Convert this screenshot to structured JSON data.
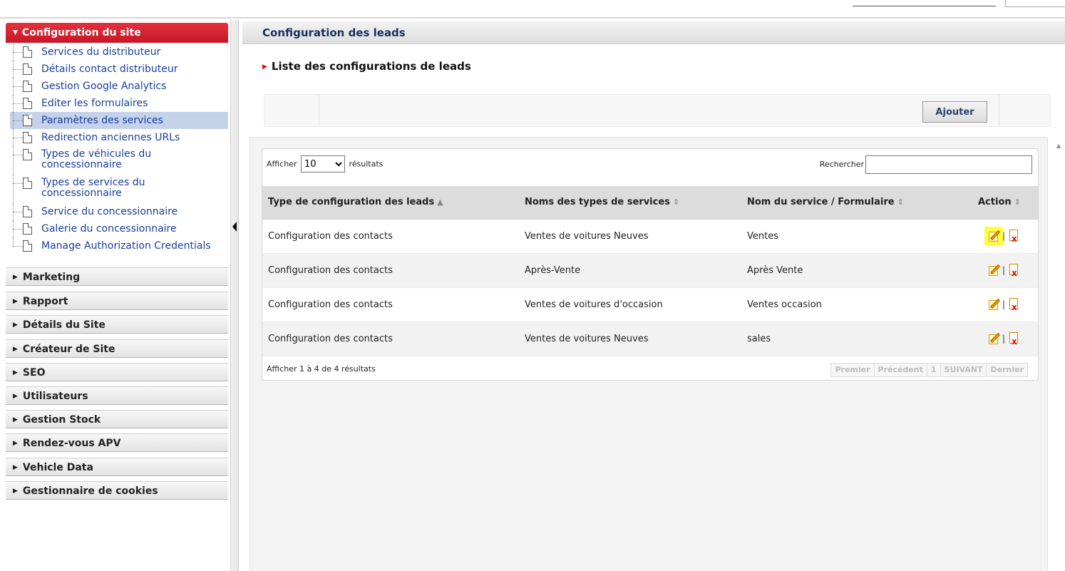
{
  "sidebar": {
    "active_section": "Configuration du site",
    "items": [
      {
        "label": "Services du distributeur"
      },
      {
        "label": "Détails contact distributeur"
      },
      {
        "label": "Gestion Google Analytics"
      },
      {
        "label": "Editer les formulaires"
      },
      {
        "label": "Paramètres des services"
      },
      {
        "label": "Redirection anciennes URLs"
      },
      {
        "label": "Types de véhicules du concessionnaire"
      },
      {
        "label": "Types de services du concessionnaire"
      },
      {
        "label": "Service du concessionnaire"
      },
      {
        "label": "Galerie du concessionnaire"
      },
      {
        "label": "Manage Authorization Credentials"
      }
    ],
    "sections": [
      {
        "label": "Marketing"
      },
      {
        "label": "Rapport"
      },
      {
        "label": "Détails du Site"
      },
      {
        "label": "Créateur de Site"
      },
      {
        "label": "SEO"
      },
      {
        "label": "Utilisateurs"
      },
      {
        "label": "Gestion Stock"
      },
      {
        "label": "Rendez-vous APV"
      },
      {
        "label": "Vehicle Data"
      },
      {
        "label": "Gestionnaire de cookies"
      }
    ]
  },
  "main": {
    "page_title": "Configuration des leads",
    "subtitle": "Liste des configurations de leads",
    "add_button": "Ajouter",
    "length_prefix": "Afficher",
    "length_value": "10",
    "length_suffix": "résultats",
    "search_label": "Rechercher",
    "search_value": "",
    "columns": [
      "Type de configuration des leads",
      "Noms des types de services",
      "Nom du service / Formulaire",
      "Action"
    ],
    "rows": [
      {
        "type": "Configuration des contacts",
        "service_type": "Ventes de voitures Neuves",
        "service": "Ventes"
      },
      {
        "type": "Configuration des contacts",
        "service_type": "Après-Vente",
        "service": "Après Vente"
      },
      {
        "type": "Configuration des contacts",
        "service_type": "Ventes de voitures d'occasion",
        "service": "Ventes occasion"
      },
      {
        "type": "Configuration des contacts",
        "service_type": "Ventes de voitures Neuves",
        "service": "sales"
      }
    ],
    "info": "Afficher 1 à 4 de 4 résultats",
    "pager": {
      "first": "Premier",
      "prev": "Précédent",
      "page": "1",
      "next": "SUIVANT",
      "last": "Dernier"
    },
    "action_separator": "|"
  },
  "colors": {
    "active_section": "#d41f2f",
    "link": "#1a3f9e",
    "selected_item": "#c4d2ea",
    "highlight": "#ffff40"
  }
}
